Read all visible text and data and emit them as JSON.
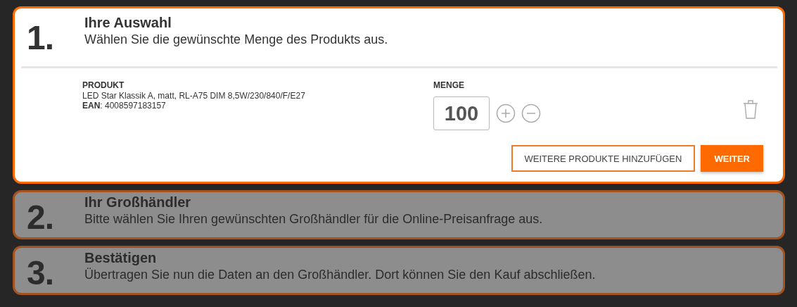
{
  "steps": [
    {
      "number": "1.",
      "title": "Ihre Auswahl",
      "description": "Wählen Sie die gewünschte Menge des Produkts aus.",
      "active": true
    },
    {
      "number": "2.",
      "title": "Ihr Großhändler",
      "description": "Bitte wählen Sie Ihren gewünschten Großhändler für die Online-Preisanfrage aus.",
      "active": false
    },
    {
      "number": "3.",
      "title": "Bestätigen",
      "description": "Übertragen Sie nun die Daten an den Großhändler. Dort können Sie den Kauf abschließen.",
      "active": false
    }
  ],
  "product": {
    "label": "PRODUKT",
    "name": "LED Star Klassik A, matt, RL-A75 DIM 8,5W/230/840/F/E27",
    "ean": "**EAN**: 4008597183157"
  },
  "quantity": {
    "label": "MENGE",
    "value": "100"
  },
  "buttons": [
    {
      "label": "WEITERE PRODUKTE HINZUFÜGEN",
      "kind": "secondary"
    },
    {
      "label": "WEITER",
      "kind": "primary"
    }
  ]
}
